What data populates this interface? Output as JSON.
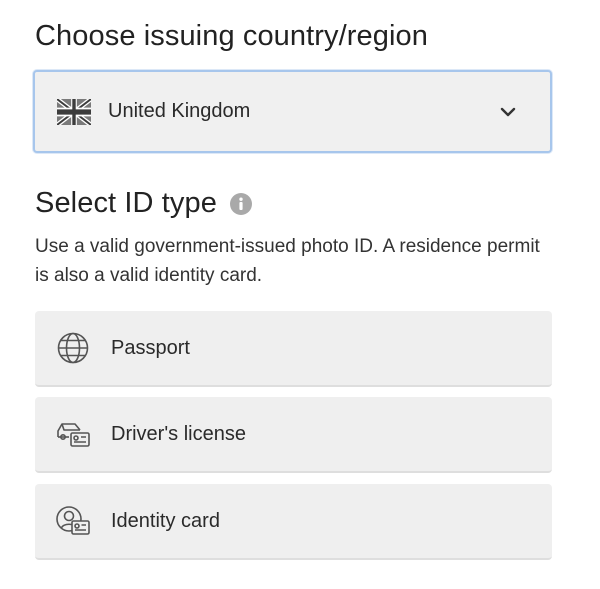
{
  "country_section": {
    "heading": "Choose issuing country/region",
    "selected_country": "United Kingdom",
    "flag_icon": "uk-flag-icon",
    "dropdown_icon": "chevron-down-icon"
  },
  "id_type_section": {
    "heading": "Select ID type",
    "info_icon": "info-icon",
    "help_text": "Use a valid government-issued photo ID. A residence permit is also a valid identity card.",
    "options": [
      {
        "label": "Passport",
        "icon": "globe-icon"
      },
      {
        "label": "Driver's license",
        "icon": "car-card-icon"
      },
      {
        "label": "Identity card",
        "icon": "person-card-icon"
      }
    ]
  },
  "colors": {
    "select_border": "#a7c6ec",
    "option_background": "#efefef",
    "text": "#222222",
    "info_icon": "#a9a9a9"
  }
}
